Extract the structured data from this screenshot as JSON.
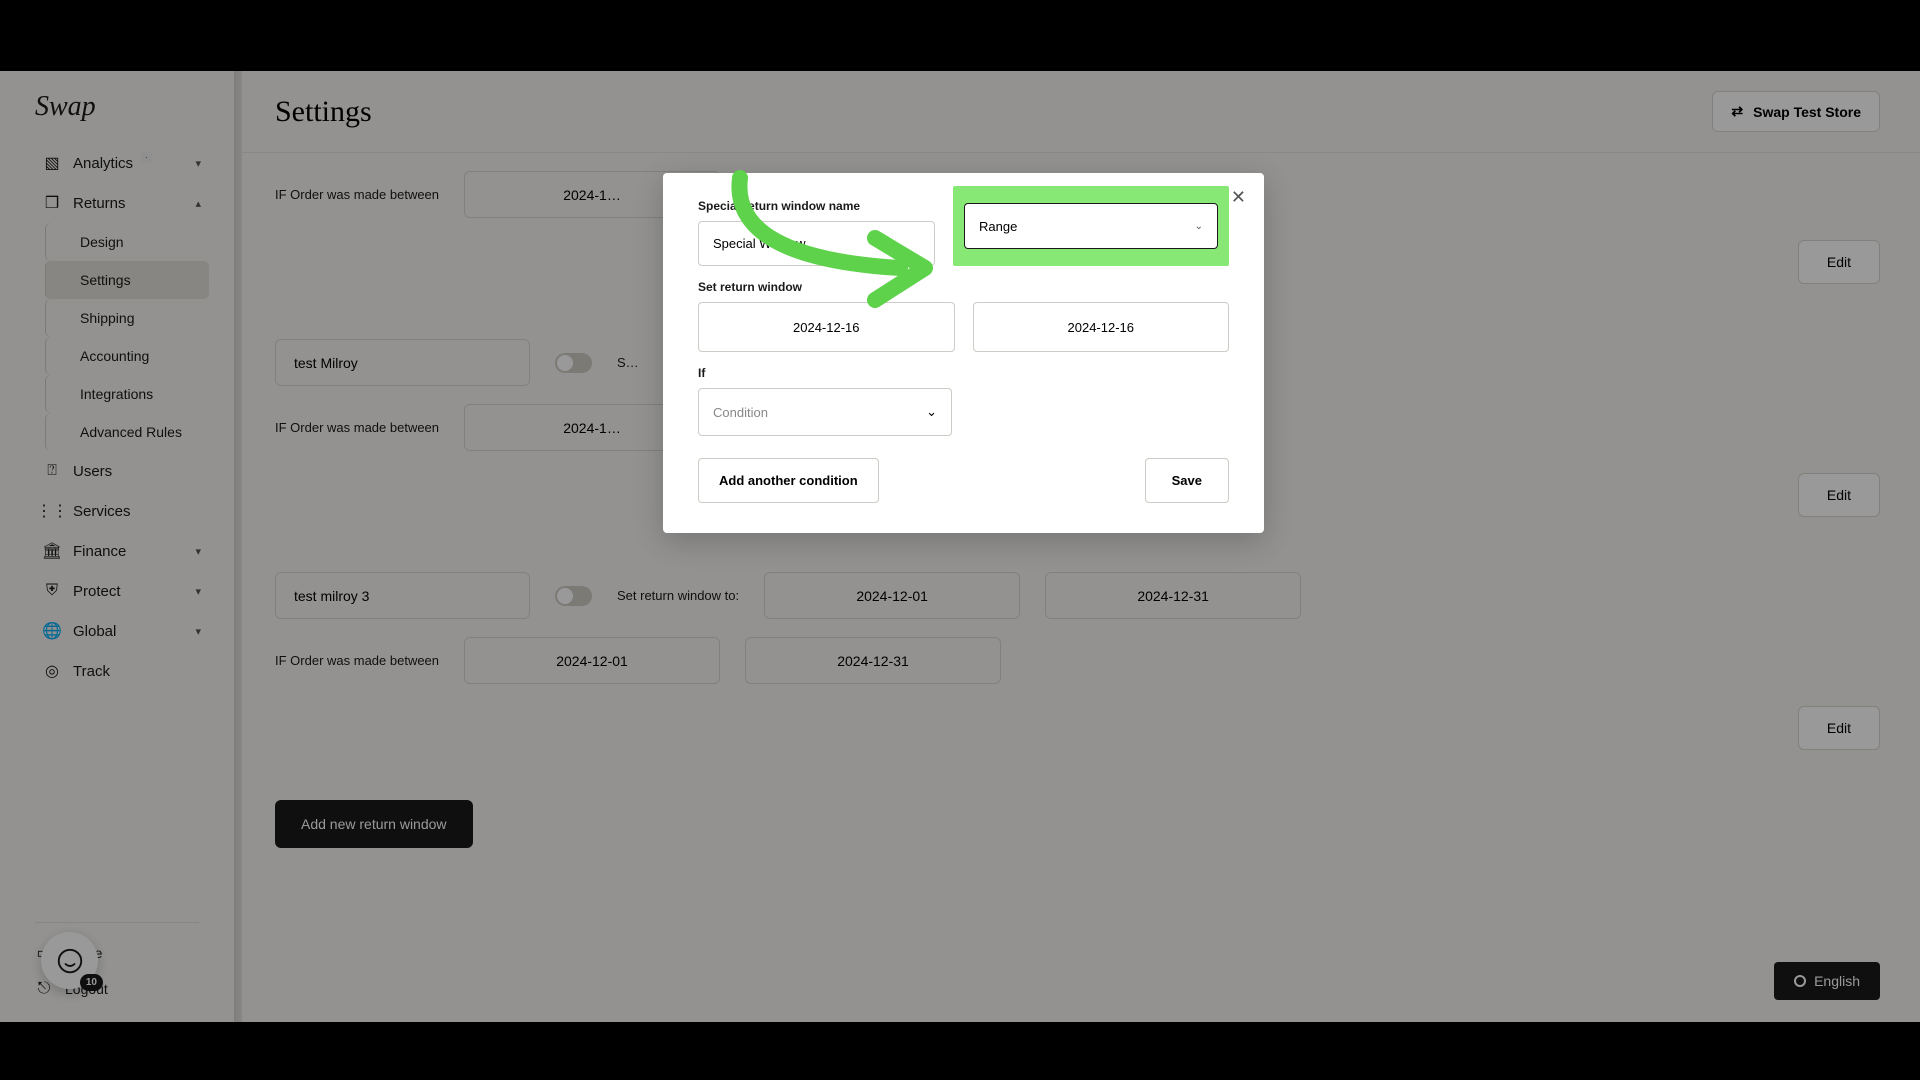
{
  "brand": "Swap",
  "page_title": "Settings",
  "store_selector": {
    "label": "Swap Test Store"
  },
  "sidebar": {
    "items": [
      {
        "label": "Analytics",
        "icon": "chart",
        "expandable": true,
        "beta": true
      },
      {
        "label": "Returns",
        "icon": "box",
        "expandable": true,
        "open": true
      },
      {
        "label": "Design",
        "sub": true
      },
      {
        "label": "Settings",
        "sub": true,
        "active": true
      },
      {
        "label": "Shipping",
        "sub": true
      },
      {
        "label": "Accounting",
        "sub": true
      },
      {
        "label": "Integrations",
        "sub": true
      },
      {
        "label": "Advanced Rules",
        "sub": true
      },
      {
        "label": "Users",
        "icon": "user"
      },
      {
        "label": "Services",
        "icon": "grid"
      },
      {
        "label": "Finance",
        "icon": "bank",
        "expandable": true
      },
      {
        "label": "Protect",
        "icon": "shield",
        "expandable": true
      },
      {
        "label": "Global",
        "icon": "globe",
        "expandable": true
      },
      {
        "label": "Track",
        "icon": "target"
      }
    ],
    "footer": [
      {
        "label": "Guide",
        "icon": "book"
      },
      {
        "label": "Logout",
        "icon": "exit"
      }
    ]
  },
  "windows": [
    {
      "name": "",
      "cond_label": "IF Order was made between",
      "date1": "2024-1…",
      "edit": "Edit"
    },
    {
      "name": "test Milroy",
      "set_label": "S…",
      "cond_label": "IF Order was made between",
      "date1": "2024-1…",
      "edit": "Edit"
    },
    {
      "name": "test milroy 3",
      "set_label": "Set return window to:",
      "set_date1": "2024-12-01",
      "set_date2": "2024-12-31",
      "cond_label": "IF Order was made between",
      "date1": "2024-12-01",
      "date2": "2024-12-31",
      "edit": "Edit"
    }
  ],
  "add_button": "Add new return window",
  "modal": {
    "name_label": "Special return window name",
    "name_value": "Special Window",
    "type_value": "Range",
    "set_label": "Set return window",
    "date1": "2024-12-16",
    "date2": "2024-12-16",
    "if_label": "If",
    "condition_placeholder": "Condition",
    "add_condition": "Add another condition",
    "save": "Save"
  },
  "help_badge": "10",
  "language": "English"
}
